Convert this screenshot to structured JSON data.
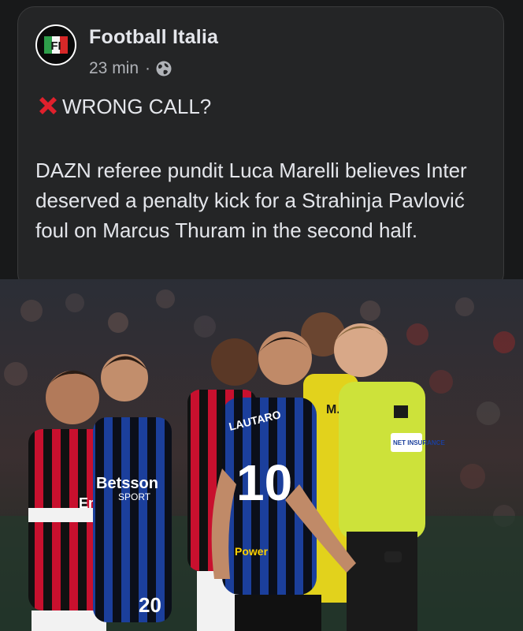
{
  "post": {
    "page_name": "Football Italia",
    "timestamp": "23 min",
    "separator": "·",
    "privacy_icon": "globe-icon",
    "headline": "WRONG CALL?",
    "headline_icon": "red-cross-mark-icon",
    "body": "DAZN referee pundit Luca Marelli believes Inter deserved a penalty kick for a Strahinja Pavlović foul on Marcus Thuram in the second half.",
    "logo_letters": "FI"
  },
  "photo": {
    "jersey_name_referee": "M.MO",
    "jersey_number_lautaro": "10",
    "jersey_name_lautaro": "LAUTARO",
    "jersey_number_calhanoglu": "20",
    "sponsor_milan": "Emirates",
    "sponsor_inter": "Betsson",
    "sponsor_inter_sub": "SPORT",
    "kit_sponsor_inter": "Power",
    "referee_badge": "NET INSURANCE"
  },
  "colors": {
    "background": "#18191a",
    "card": "#242526",
    "text_primary": "#e4e6eb",
    "text_secondary": "#b0b3b8",
    "milan_red": "#c8102e",
    "inter_blue": "#1b3f9c",
    "referee_yellow": "#d4e635"
  }
}
